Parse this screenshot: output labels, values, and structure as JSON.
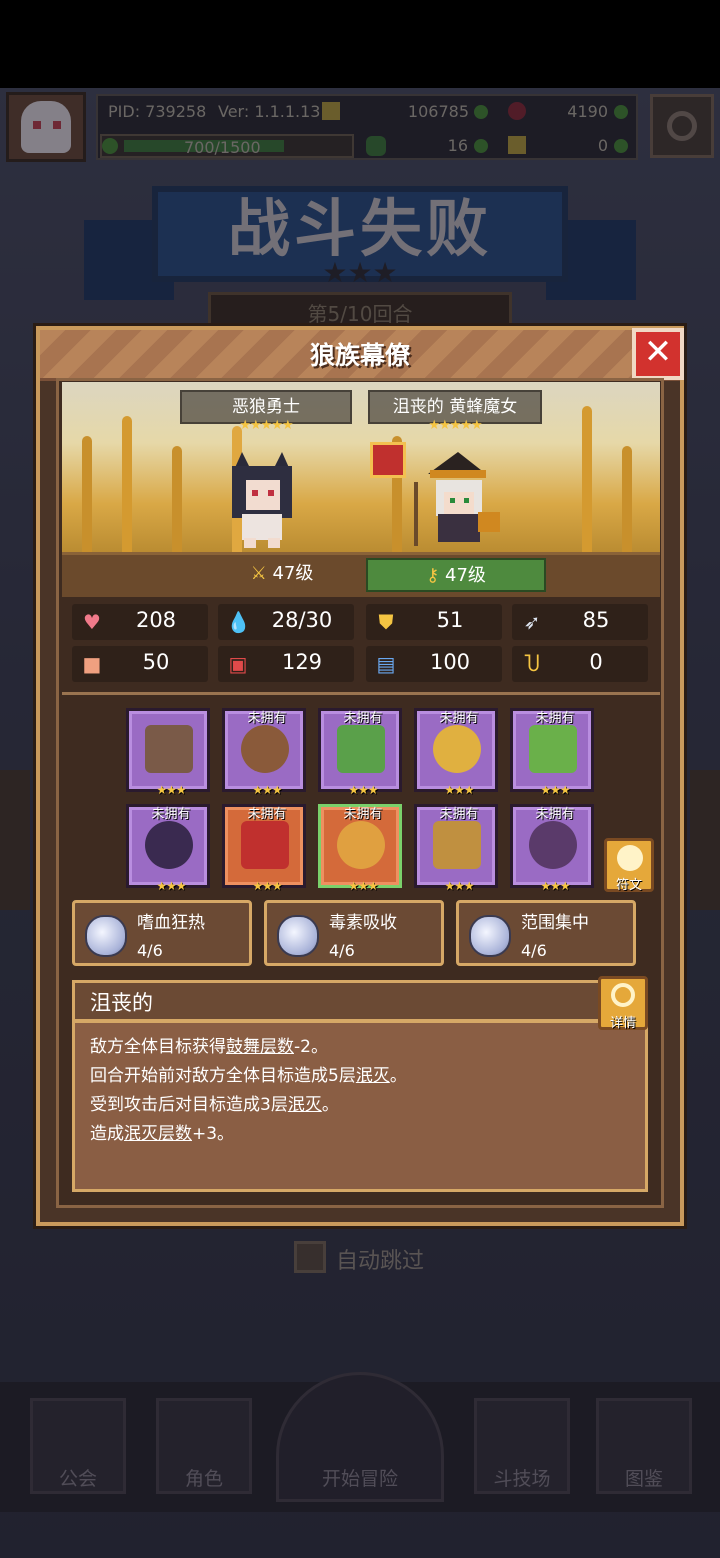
{
  "header": {
    "pid": "PID: 739258",
    "version": "Ver: 1.1.1.13",
    "gold": "106785",
    "gems": "4190",
    "xp": "700/1500",
    "clover": "16",
    "keys": "0"
  },
  "battle": {
    "result_title": "战斗失败",
    "round": "第5/10回合",
    "auto_skip": "自动跳过"
  },
  "nav": {
    "guild": "公会",
    "character": "角色",
    "start": "开始冒险",
    "arena": "斗技场",
    "codex": "图鉴"
  },
  "modal": {
    "title": "狼族幕僚",
    "close_icon": "close-icon",
    "hero1": {
      "name": "恶狼勇士",
      "stars": "★★★★★",
      "level": "47级"
    },
    "hero2": {
      "name": "沮丧的 黄蜂魔女",
      "stars": "★★★★★",
      "level": "47级"
    },
    "stats": [
      {
        "icon": "heart-icon",
        "symbol": "♥",
        "color": "#f07a8a",
        "value": "208"
      },
      {
        "icon": "mana-drop-icon",
        "symbol": "💧",
        "color": "#5ab0e8",
        "value": "28/30"
      },
      {
        "icon": "shield-icon",
        "symbol": "⛊",
        "color": "#f5c542",
        "value": "51"
      },
      {
        "icon": "wing-icon",
        "symbol": "➶",
        "color": "#dfe6f2",
        "value": "85"
      },
      {
        "icon": "fist-icon",
        "symbol": "■",
        "color": "#f0a080",
        "value": "50"
      },
      {
        "icon": "spellbook-icon",
        "symbol": "▣",
        "color": "#e04a4a",
        "value": "129"
      },
      {
        "icon": "speed-boot-icon",
        "symbol": "▤",
        "color": "#6aa8f0",
        "value": "100"
      },
      {
        "icon": "horseshoe-icon",
        "symbol": "Ⴎ",
        "color": "#f5c542",
        "value": "0"
      }
    ],
    "equipment": [
      {
        "name": "staff-icon",
        "label": "",
        "stars": "★★★",
        "rarity": "purple"
      },
      {
        "name": "round-shield-icon",
        "label": "未拥有",
        "stars": "★★★",
        "rarity": "purple"
      },
      {
        "name": "amulet-icon",
        "label": "未拥有",
        "stars": "★★★",
        "rarity": "purple"
      },
      {
        "name": "golden-orb-icon",
        "label": "未拥有",
        "stars": "★★★",
        "rarity": "purple"
      },
      {
        "name": "green-ring-icon",
        "label": "未拥有",
        "stars": "★★★",
        "rarity": "purple"
      },
      {
        "name": "witch-hat-icon",
        "label": "未拥有",
        "stars": "★★★",
        "rarity": "purple"
      },
      {
        "name": "red-armor-icon",
        "label": "未拥有",
        "stars": "★★★",
        "rarity": "orange"
      },
      {
        "name": "gauntlet-icon",
        "label": "未拥有",
        "stars": "★★★",
        "rarity": "green"
      },
      {
        "name": "gold-bracelet-icon",
        "label": "未拥有",
        "stars": "★★★",
        "rarity": "purple"
      },
      {
        "name": "boots-icon",
        "label": "未拥有",
        "stars": "★★★",
        "rarity": "purple"
      }
    ],
    "rune_label": "符文",
    "skills": [
      {
        "name": "嗜血狂热",
        "progress": "4/6"
      },
      {
        "name": "毒素吸收",
        "progress": "4/6"
      },
      {
        "name": "范围集中",
        "progress": "4/6"
      }
    ],
    "trait": {
      "title": "沮丧的",
      "detail_label": "详情",
      "lines": [
        {
          "pre": "敌方全体目标获得",
          "kw": "鼓舞层数",
          "post": "-2。"
        },
        {
          "pre": "回合开始前对敌方全体目标造成5层",
          "kw": "泯灭",
          "post": "。"
        },
        {
          "pre": "受到攻击后对目标造成3层",
          "kw": "泯灭",
          "post": "。"
        },
        {
          "pre": "造成",
          "kw": "泯灭层数",
          "post": "+3。"
        }
      ]
    }
  }
}
